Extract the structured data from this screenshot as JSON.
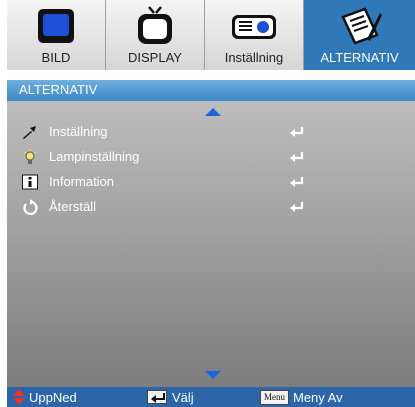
{
  "tabs": [
    {
      "label": "BILD",
      "icon": "monitor-icon",
      "active": false
    },
    {
      "label": "DISPLAY",
      "icon": "tv-icon",
      "active": false
    },
    {
      "label": "Inställning",
      "icon": "projector-icon",
      "active": false
    },
    {
      "label": "ALTERNATIV",
      "icon": "notepad-pen-icon",
      "active": true
    }
  ],
  "header": {
    "title": "ALTERNATIV"
  },
  "menu": {
    "items": [
      {
        "label": "Inställning",
        "icon": "wrench-icon"
      },
      {
        "label": "Lampinställning",
        "icon": "lamp-icon"
      },
      {
        "label": "Information",
        "icon": "info-icon"
      },
      {
        "label": "Återställ",
        "icon": "reset-icon"
      }
    ]
  },
  "footer": {
    "nav_label": "UppNed",
    "select_label": "Välj",
    "menu_key": "Menu",
    "exit_label": "Meny Av"
  },
  "colors": {
    "accent": "#2f79b9",
    "header": "#4d97d0",
    "footer": "#2c66a8",
    "scroll_arrow": "#1a64d8"
  }
}
